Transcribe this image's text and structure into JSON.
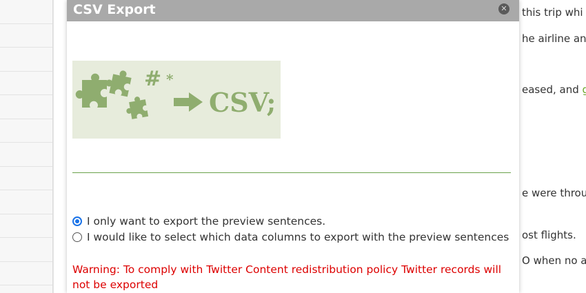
{
  "background": {
    "lines": [
      {
        "text": "this trip whi"
      },
      {
        "text": "he airline ann"
      },
      {
        "text": "eased, and ",
        "highlight": "g"
      },
      {
        "text": "e were throu"
      },
      {
        "text": "ost flights."
      },
      {
        "text": "O when no a"
      }
    ]
  },
  "dialog": {
    "title": "CSV Export",
    "close_icon": "close-icon",
    "banner_text": "CSV;",
    "options": [
      {
        "label": "I only want to export the preview sentences.",
        "checked": true
      },
      {
        "label": "I would like to select which data columns to export with the preview sentences",
        "checked": false
      }
    ],
    "warning": "Warning: To comply with Twitter Content redistribution policy Twitter records will not be exported"
  },
  "colors": {
    "titlebar": "#a9a9a9",
    "warning": "#dd0000",
    "banner_bg": "#e7ecdc",
    "puzzle_green": "#8fad6f",
    "radio_checked": "#1a73e8",
    "divider": "#6aa14a"
  }
}
